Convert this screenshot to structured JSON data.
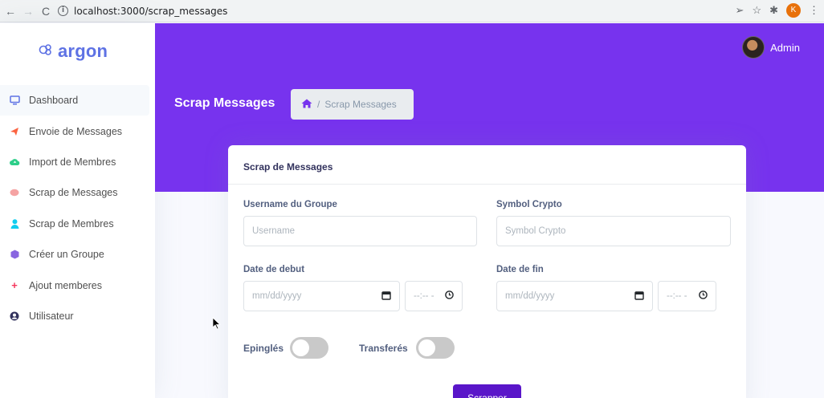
{
  "browser": {
    "back_icon": "←",
    "forward_icon": "→",
    "reload_icon": "C",
    "url": "localhost:3000/scrap_messages",
    "profile_initial": "K"
  },
  "sidebar": {
    "brand": "argon",
    "items": [
      {
        "label": "Dashboard",
        "icon": "monitor-icon",
        "color": "#5e72e4"
      },
      {
        "label": "Envoie de Messages",
        "icon": "send-icon",
        "color": "#fb6340"
      },
      {
        "label": "Import de Membres",
        "icon": "cloud-upload-icon",
        "color": "#2dce89"
      },
      {
        "label": "Scrap de Messages",
        "icon": "chat-bubble-icon",
        "color": "#f5a3a3"
      },
      {
        "label": "Scrap de Membres",
        "icon": "user-icon",
        "color": "#11cdef"
      },
      {
        "label": "Créer un Groupe",
        "icon": "box-icon",
        "color": "#8965e0"
      },
      {
        "label": "Ajout memberes",
        "icon": "plus-icon",
        "color": "#f3a4b5"
      },
      {
        "label": "Utilisateur",
        "icon": "user-circle-icon",
        "color": "#32325d"
      }
    ]
  },
  "header": {
    "user": "Admin",
    "page_title": "Scrap Messages",
    "breadcrumb": "Scrap Messages"
  },
  "card": {
    "title": "Scrap de Messages",
    "username_label": "Username du Groupe",
    "username_placeholder": "Username",
    "crypto_label": "Symbol Crypto",
    "crypto_placeholder": "Symbol Crypto",
    "start_label": "Date de debut",
    "end_label": "Date de fin",
    "date_placeholder": "mm/dd/yyyy",
    "time_placeholder": "--:-- -",
    "pinned_label": "Epinglés",
    "forwarded_label": "Transferés",
    "submit_label": "Scrapper"
  },
  "colors": {
    "header": "#7733ee",
    "brand": "#5e72e4",
    "submit": "#5a16c9"
  }
}
